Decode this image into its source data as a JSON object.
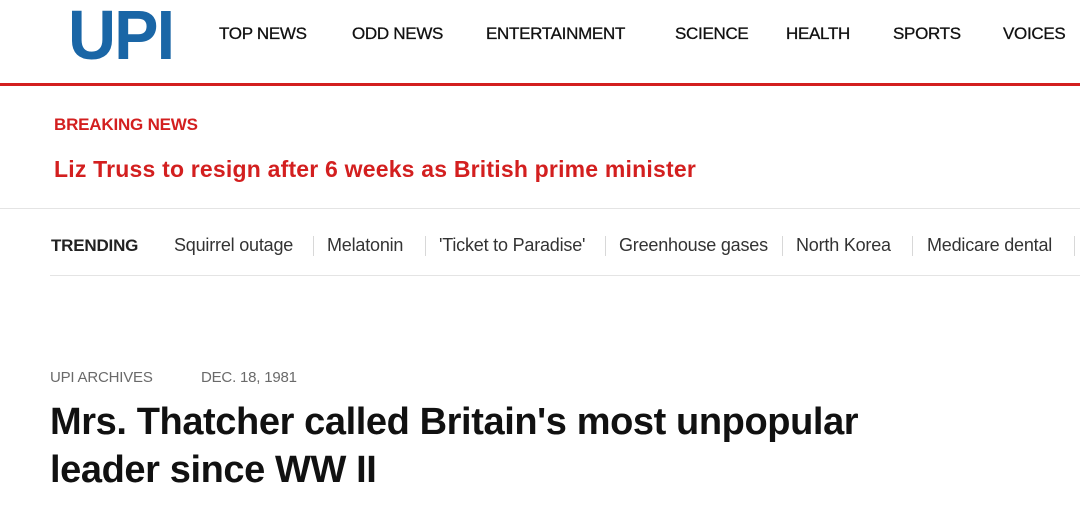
{
  "header": {
    "logo_text": "UPI",
    "logo_color": "#1a66a6",
    "nav": [
      {
        "label": "TOP NEWS"
      },
      {
        "label": "ODD NEWS"
      },
      {
        "label": "ENTERTAINMENT"
      },
      {
        "label": "SCIENCE"
      },
      {
        "label": "HEALTH"
      },
      {
        "label": "SPORTS"
      },
      {
        "label": "VOICES"
      }
    ],
    "accent_color": "#d31f1f"
  },
  "breaking": {
    "label": "BREAKING NEWS",
    "headline": "Liz Truss to resign after 6 weeks as British prime minister"
  },
  "trending": {
    "label": "TRENDING",
    "items": [
      {
        "label": "Squirrel outage"
      },
      {
        "label": "Melatonin"
      },
      {
        "label": "'Ticket to Paradise'"
      },
      {
        "label": "Greenhouse gases"
      },
      {
        "label": "North Korea"
      },
      {
        "label": "Medicare dental"
      }
    ]
  },
  "article": {
    "category": "UPI ARCHIVES",
    "date": "DEC. 18, 1981",
    "title": "Mrs. Thatcher called Britain's most unpopular leader since WW II"
  }
}
